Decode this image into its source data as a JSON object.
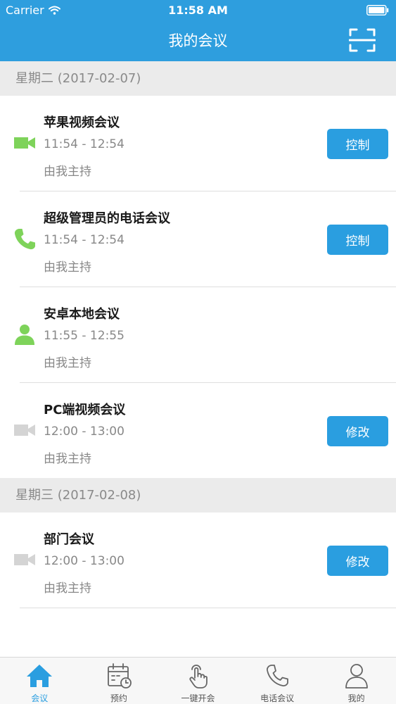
{
  "status_bar": {
    "carrier": "Carrier",
    "time": "11:58 AM"
  },
  "nav": {
    "title": "我的会议",
    "scan_icon": "scan-icon"
  },
  "sections": [
    {
      "date_label": "星期二 (2017-02-07)",
      "meetings": [
        {
          "title": "苹果视频会议",
          "time": "11:54 - 12:54",
          "host": "由我主持",
          "type_icon": "video-camera-icon",
          "status": "active",
          "action": "控制"
        },
        {
          "title": "超级管理员的电话会议",
          "time": "11:54 - 12:54",
          "host": "由我主持",
          "type_icon": "phone-icon",
          "status": "active",
          "action": "控制"
        },
        {
          "title": "安卓本地会议",
          "time": "11:55 - 12:55",
          "host": "由我主持",
          "type_icon": "person-icon",
          "status": "active",
          "action": ""
        },
        {
          "title": "PC端视频会议",
          "time": "12:00 - 13:00",
          "host": "由我主持",
          "type_icon": "video-camera-icon",
          "status": "inactive",
          "action": "修改"
        }
      ]
    },
    {
      "date_label": "星期三 (2017-02-08)",
      "meetings": [
        {
          "title": "部门会议",
          "time": "12:00 - 13:00",
          "host": "由我主持",
          "type_icon": "video-camera-icon",
          "status": "inactive",
          "action": "修改"
        }
      ]
    }
  ],
  "tabbar": {
    "tabs": [
      {
        "label": "会议",
        "icon": "home-icon",
        "active": true
      },
      {
        "label": "预约",
        "icon": "calendar-clock-icon",
        "active": false
      },
      {
        "label": "一键开会",
        "icon": "tap-hand-icon",
        "active": false
      },
      {
        "label": "电话会议",
        "icon": "phone-icon",
        "active": false
      },
      {
        "label": "我的",
        "icon": "user-icon",
        "active": false
      }
    ]
  },
  "colors": {
    "primary": "#2e9ede",
    "button": "#2a9ee0",
    "active_icon": "#7ed35a",
    "inactive_icon": "#d4d4d4",
    "section_bg": "#ebebeb"
  }
}
